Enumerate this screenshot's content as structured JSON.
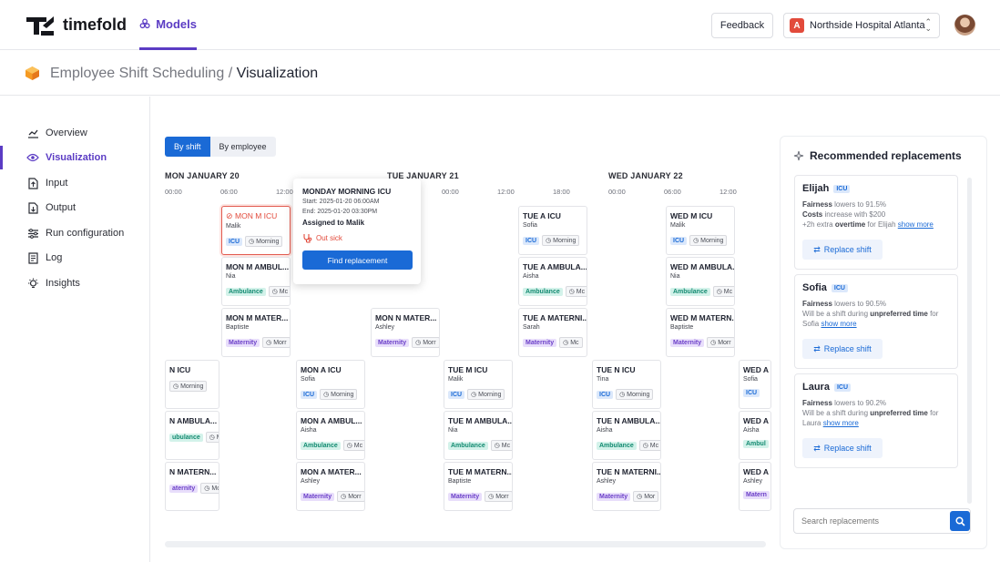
{
  "app": {
    "logo_text": "timefold",
    "models_tab": "Models"
  },
  "header": {
    "feedback": "Feedback",
    "tenant_badge": "A",
    "tenant": "Northside Hospital Atlanta"
  },
  "breadcrumb": {
    "model": "Employee Shift Scheduling",
    "separator": "/",
    "page": "Visualization"
  },
  "sidebar": {
    "items": [
      {
        "label": "Overview",
        "icon": "overview-icon"
      },
      {
        "label": "Visualization",
        "icon": "eye-icon"
      },
      {
        "label": "Input",
        "icon": "input-file-icon"
      },
      {
        "label": "Output",
        "icon": "output-file-icon"
      },
      {
        "label": "Run configuration",
        "icon": "sliders-icon"
      },
      {
        "label": "Log",
        "icon": "log-icon"
      },
      {
        "label": "Insights",
        "icon": "lightbulb-icon"
      }
    ]
  },
  "view_toggle": {
    "by_shift": "By shift",
    "by_employee": "By employee",
    "selected": "By shift"
  },
  "days": [
    {
      "label": "MON JANUARY 20",
      "ticks": [
        "00:00",
        "06:00",
        "12:00"
      ]
    },
    {
      "label": "TUE JANUARY 21",
      "ticks": [
        "00:00",
        "12:00",
        "18:00"
      ]
    },
    {
      "label": "WED JANUARY 22",
      "ticks": [
        "00:00",
        "06:00",
        "12:00"
      ]
    }
  ],
  "shifts": [
    {
      "title": "MON M ICU",
      "name": "Malik",
      "tag": "ICU",
      "tag_type": "icu",
      "time": "Morning",
      "sick": true
    },
    {
      "title": "MON M AMBUL...",
      "name": "Nia",
      "tag": "Ambulance",
      "tag_type": "amb",
      "time": "Mc"
    },
    {
      "title": "MON M MATER...",
      "name": "Baptiste",
      "tag": "Maternity",
      "tag_type": "mat",
      "time": "Morr"
    },
    {
      "title": "MON N MATER...",
      "name": "Ashley",
      "tag": "Maternity",
      "tag_type": "mat",
      "time": "Morr"
    },
    {
      "title": "TUE A ICU",
      "name": "Sofia",
      "tag": "ICU",
      "tag_type": "icu",
      "time": "Morning"
    },
    {
      "title": "TUE A AMBULA...",
      "name": "Aisha",
      "tag": "Ambulance",
      "tag_type": "amb",
      "time": "Mc"
    },
    {
      "title": "TUE A MATERNI...",
      "name": "Sarah",
      "tag": "Maternity",
      "tag_type": "mat",
      "time": "Mc"
    },
    {
      "title": "WED M ICU",
      "name": "Malik",
      "tag": "ICU",
      "tag_type": "icu",
      "time": "Morning"
    },
    {
      "title": "WED M AMBULA...",
      "name": "Nia",
      "tag": "Ambulance",
      "tag_type": "amb",
      "time": "Mc"
    },
    {
      "title": "WED M MATERN...",
      "name": "Baptiste",
      "tag": "Maternity",
      "tag_type": "mat",
      "time": "Morr"
    },
    {
      "title": "N ICU",
      "name": "",
      "tag": "",
      "tag_type": "",
      "time": "Morning"
    },
    {
      "title": "N AMBULA...",
      "name": "",
      "tag": "ubulance",
      "tag_type": "amb",
      "time": "Mc"
    },
    {
      "title": "N MATERN...",
      "name": "",
      "tag": "aternity",
      "tag_type": "mat",
      "time": "Morr"
    },
    {
      "title": "MON A ICU",
      "name": "Sofia",
      "tag": "ICU",
      "tag_type": "icu",
      "time": "Morning"
    },
    {
      "title": "MON A AMBUL...",
      "name": "Aisha",
      "tag": "Ambulance",
      "tag_type": "amb",
      "time": "Mc"
    },
    {
      "title": "MON A MATER...",
      "name": "Ashley",
      "tag": "Maternity",
      "tag_type": "mat",
      "time": "Morr"
    },
    {
      "title": "TUE M ICU",
      "name": "Malik",
      "tag": "ICU",
      "tag_type": "icu",
      "time": "Morning"
    },
    {
      "title": "TUE M AMBULA...",
      "name": "Nia",
      "tag": "Ambulance",
      "tag_type": "amb",
      "time": "Mc"
    },
    {
      "title": "TUE M MATERN...",
      "name": "Baptiste",
      "tag": "Maternity",
      "tag_type": "mat",
      "time": "Morr"
    },
    {
      "title": "TUE N ICU",
      "name": "Tina",
      "tag": "ICU",
      "tag_type": "icu",
      "time": "Morning"
    },
    {
      "title": "TUE N AMBULA...",
      "name": "Aisha",
      "tag": "Ambulance",
      "tag_type": "amb",
      "time": "Mc"
    },
    {
      "title": "TUE N MATERNI...",
      "name": "Ashley",
      "tag": "Maternity",
      "tag_type": "mat",
      "time": "Mor"
    },
    {
      "title": "WED A",
      "name": "Sofia",
      "tag": "ICU",
      "tag_type": "icu",
      "time": ""
    },
    {
      "title": "WED A",
      "name": "Aisha",
      "tag": "Ambul",
      "tag_type": "amb",
      "time": ""
    },
    {
      "title": "WED A",
      "name": "Ashley",
      "tag": "Matern",
      "tag_type": "mat",
      "time": ""
    }
  ],
  "popup": {
    "title": "MONDAY MORNING ICU",
    "start": "Start: 2025-01-20 06:00AM",
    "end": "End: 2025-01-20 03:30PM",
    "assigned": "Assigned to Malik",
    "status": "Out sick",
    "button": "Find replacement"
  },
  "recommendations": {
    "title": "Recommended replacements",
    "items": [
      {
        "name": "Elijah",
        "tag": "ICU",
        "line1_b": "Fairness",
        "line1": " lowers to 91.5%",
        "line2_b": "Costs",
        "line2": " increase with $200",
        "line3_pre": "+2h extra ",
        "line3_b": "overtime",
        "line3_post": " for Elijah ",
        "link": "show more",
        "button": "Replace shift"
      },
      {
        "name": "Sofia",
        "tag": "ICU",
        "line1_b": "Fairness",
        "line1": " lowers to 90.5%",
        "line2_b": "",
        "line2": "Will be a shift during ",
        "line2_strong": "unpreferred time",
        "line2_post": " for",
        "line3_pre": "Sofia ",
        "link": "show more",
        "button": "Replace shift"
      },
      {
        "name": "Laura",
        "tag": "ICU",
        "line1_b": "Fairness",
        "line1": " lowers to 90.2%",
        "line2_b": "",
        "line2": "Will be a shift during ",
        "line2_strong": "unpreferred time",
        "line2_post": " for",
        "line3_pre": "Laura ",
        "link": "show more",
        "button": "Replace shift"
      }
    ],
    "search_placeholder": "Search replacements"
  },
  "colors": {
    "brand": "#5b3cc4",
    "primary": "#1a6ad6",
    "danger": "#e24a3b"
  }
}
